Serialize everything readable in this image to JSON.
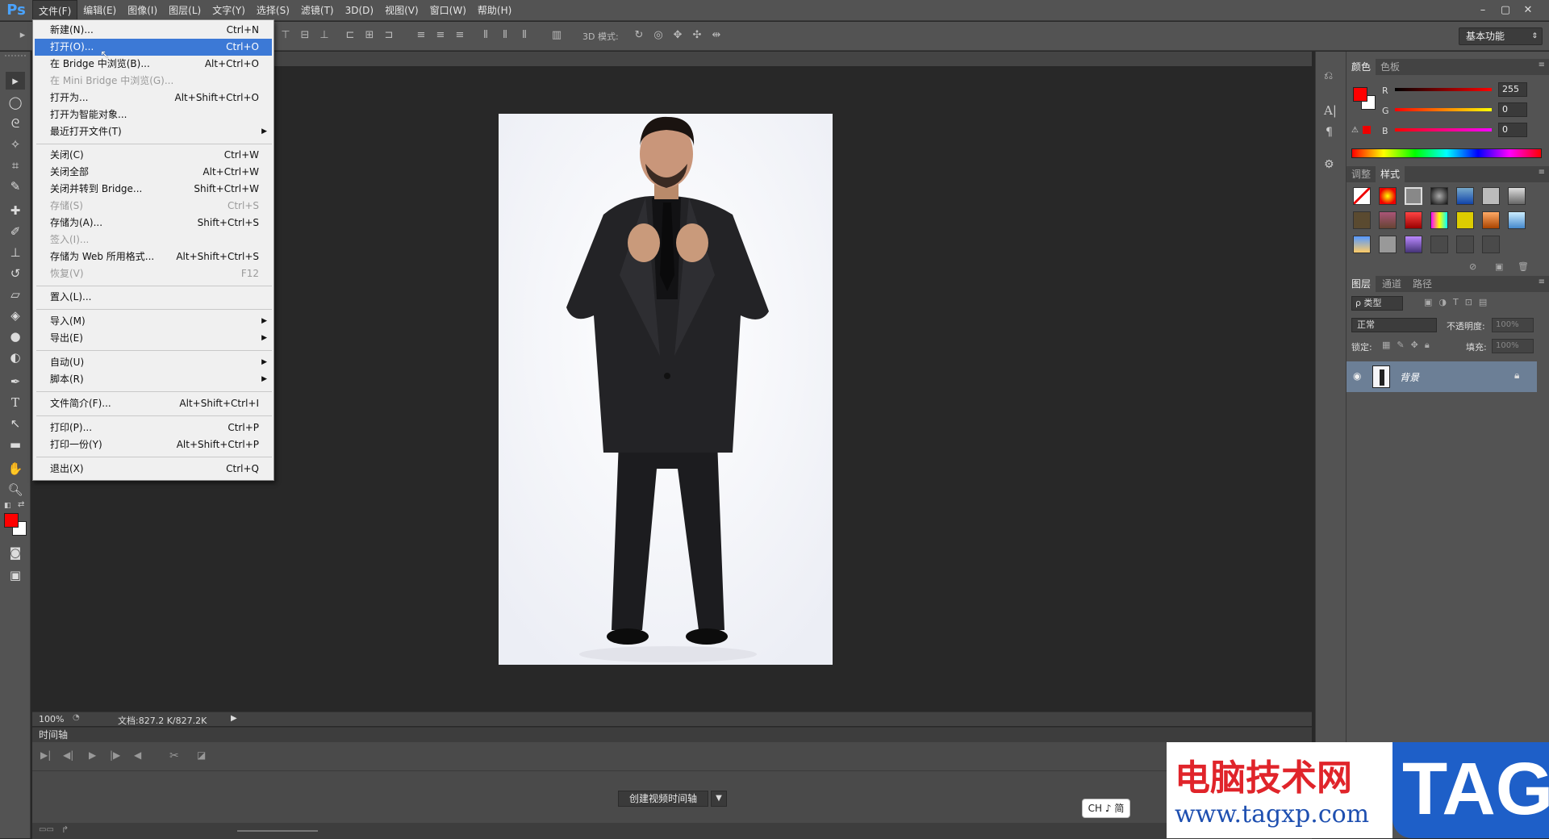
{
  "app": {
    "logo": "Ps"
  },
  "menubar": {
    "items": [
      "文件(F)",
      "编辑(E)",
      "图像(I)",
      "图层(L)",
      "文字(Y)",
      "选择(S)",
      "滤镜(T)",
      "3D(D)",
      "视图(V)",
      "窗口(W)",
      "帮助(H)"
    ],
    "window_controls": [
      "–",
      "▢",
      "✕"
    ]
  },
  "options": {
    "mode_label": "3D 模式:",
    "workspace": "基本功能"
  },
  "file_menu": {
    "items": [
      {
        "label": "新建(N)...",
        "shortcut": "Ctrl+N"
      },
      {
        "label": "打开(O)...",
        "shortcut": "Ctrl+O"
      },
      {
        "label": "在 Bridge 中浏览(B)...",
        "shortcut": "Alt+Ctrl+O"
      },
      {
        "label": "在 Mini Bridge 中浏览(G)...",
        "shortcut": ""
      },
      {
        "label": "打开为...",
        "shortcut": "Alt+Shift+Ctrl+O"
      },
      {
        "label": "打开为智能对象...",
        "shortcut": ""
      },
      {
        "label": "最近打开文件(T)",
        "shortcut": ""
      },
      {
        "label": "关闭(C)",
        "shortcut": "Ctrl+W"
      },
      {
        "label": "关闭全部",
        "shortcut": "Alt+Ctrl+W"
      },
      {
        "label": "关闭并转到 Bridge...",
        "shortcut": "Shift+Ctrl+W"
      },
      {
        "label": "存储(S)",
        "shortcut": "Ctrl+S"
      },
      {
        "label": "存储为(A)...",
        "shortcut": "Shift+Ctrl+S"
      },
      {
        "label": "签入(I)...",
        "shortcut": ""
      },
      {
        "label": "存储为 Web 所用格式...",
        "shortcut": "Alt+Shift+Ctrl+S"
      },
      {
        "label": "恢复(V)",
        "shortcut": "F12"
      },
      {
        "label": "置入(L)...",
        "shortcut": ""
      },
      {
        "label": "导入(M)",
        "shortcut": ""
      },
      {
        "label": "导出(E)",
        "shortcut": ""
      },
      {
        "label": "自动(U)",
        "shortcut": ""
      },
      {
        "label": "脚本(R)",
        "shortcut": ""
      },
      {
        "label": "文件简介(F)...",
        "shortcut": "Alt+Shift+Ctrl+I"
      },
      {
        "label": "打印(P)...",
        "shortcut": "Ctrl+P"
      },
      {
        "label": "打印一份(Y)",
        "shortcut": "Alt+Shift+Ctrl+P"
      },
      {
        "label": "退出(X)",
        "shortcut": "Ctrl+Q"
      }
    ]
  },
  "status": {
    "zoom": "100%",
    "doc_info": "文档:827.2 K/827.2K"
  },
  "timeline": {
    "title": "时间轴",
    "create_button": "创建视频时间轴"
  },
  "color_panel": {
    "tabs": [
      "颜色",
      "色板"
    ],
    "r_label": "R",
    "g_label": "G",
    "b_label": "B",
    "r": "255",
    "g": "0",
    "b": "0",
    "foreground": "#ff0000",
    "background": "#ffffff"
  },
  "styles_panel": {
    "tabs": [
      "调整",
      "样式"
    ]
  },
  "layers_panel": {
    "tabs": [
      "图层",
      "通道",
      "路径"
    ],
    "filter_label": "ρ 类型",
    "blend_mode": "正常",
    "opacity_label": "不透明度:",
    "opacity": "100%",
    "lock_label": "锁定:",
    "fill_label": "填充:",
    "fill": "100%",
    "layer_name": "背景"
  },
  "ime": {
    "text": "CH ♪ 简"
  },
  "watermark": {
    "title": "电脑技术网",
    "url": "www.tagxp.com",
    "badge": "TAG"
  }
}
